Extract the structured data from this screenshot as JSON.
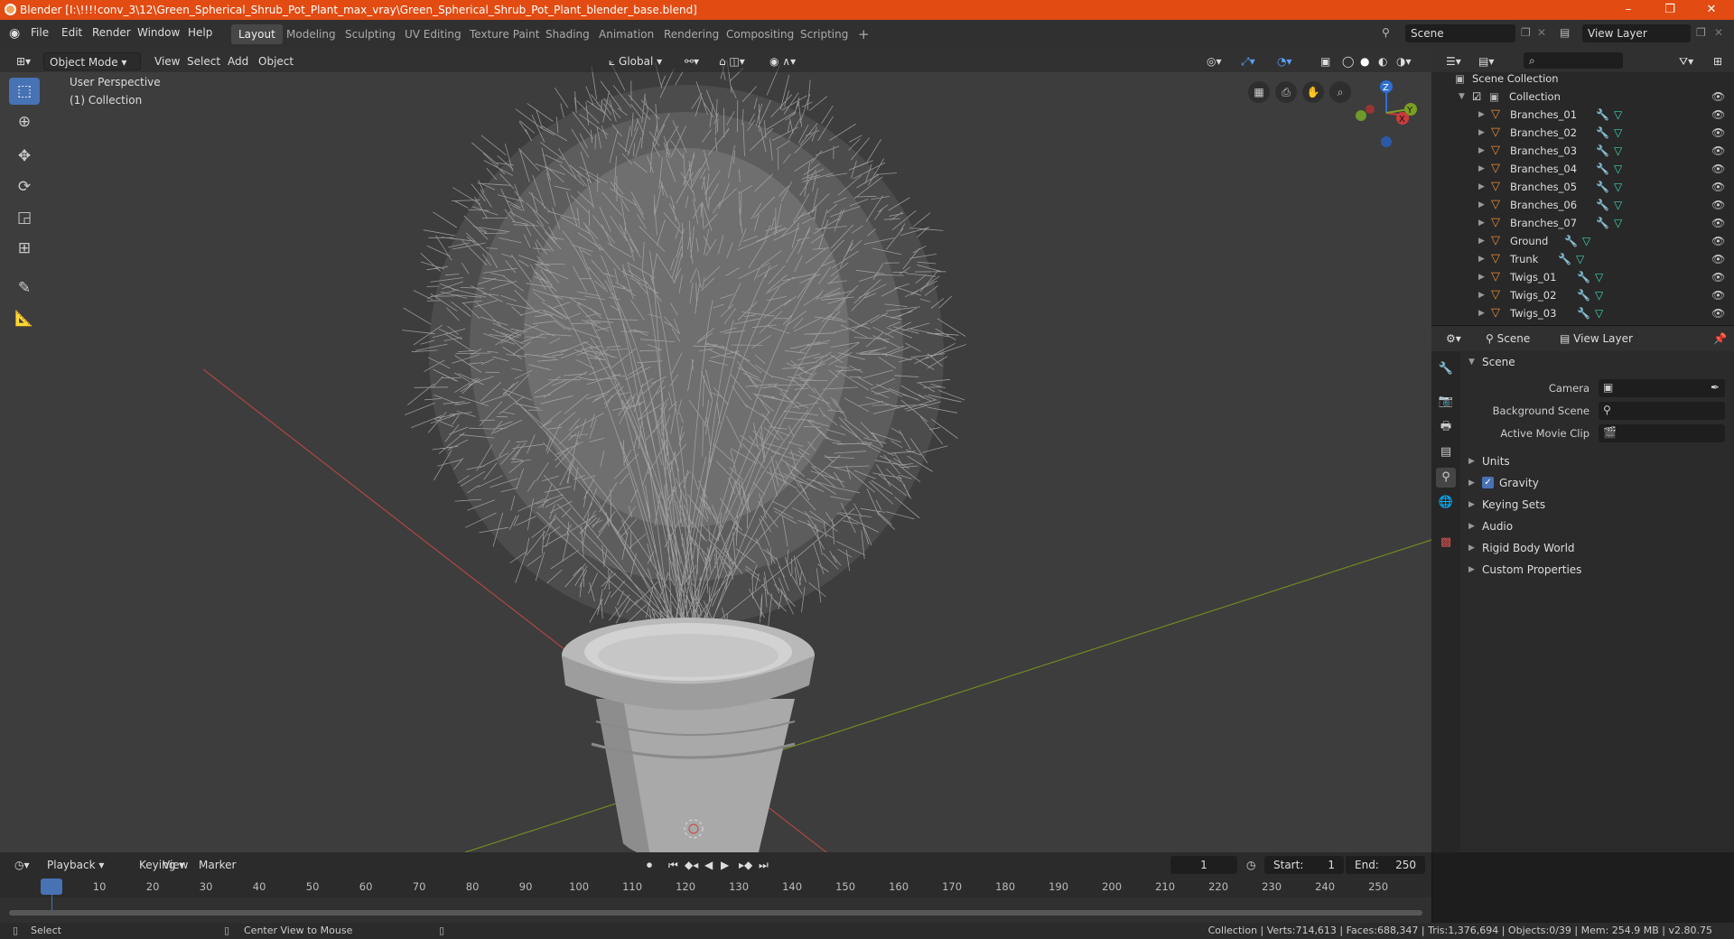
{
  "titlebar": {
    "title": "Blender [I:\\!!!!conv_3\\12\\Green_Spherical_Shrub_Pot_Plant_max_vray\\Green_Spherical_Shrub_Pot_Plant_blender_base.blend]",
    "minimize": "–",
    "maximize": "❐",
    "close": "✕"
  },
  "menu": [
    "File",
    "Edit",
    "Render",
    "Window",
    "Help"
  ],
  "workspaces": [
    "Layout",
    "Modeling",
    "Sculpting",
    "UV Editing",
    "Texture Paint",
    "Shading",
    "Animation",
    "Rendering",
    "Compositing",
    "Scripting"
  ],
  "workspace_add": "+",
  "scene_field": "Scene",
  "view_layer_field": "View Layer",
  "viewport_header": {
    "mode": "Object Mode",
    "menus": [
      "View",
      "Select",
      "Add",
      "Object"
    ],
    "orientation": "Global"
  },
  "viewport_overlay": {
    "perspective": "User Perspective",
    "collection": "(1) Collection"
  },
  "gizmo": {
    "z": "Z",
    "y": "Y",
    "x": "X"
  },
  "outliner": {
    "scene_collection": "Scene Collection",
    "collection": "Collection",
    "items": [
      "Branches_01",
      "Branches_02",
      "Branches_03",
      "Branches_04",
      "Branches_05",
      "Branches_06",
      "Branches_07",
      "Ground",
      "Trunk",
      "Twigs_01",
      "Twigs_02",
      "Twigs_03"
    ]
  },
  "properties": {
    "tab_scene": "Scene",
    "tab_view_layer": "View Layer",
    "section_scene": "Scene",
    "camera_label": "Camera",
    "background_scene_label": "Background Scene",
    "active_movie_clip_label": "Active Movie Clip",
    "sections": [
      "Units",
      "Gravity",
      "Keying Sets",
      "Audio",
      "Rigid Body World",
      "Custom Properties"
    ]
  },
  "timeline": {
    "menus": [
      "Playback",
      "Keying",
      "View",
      "Marker"
    ],
    "current_frame": "1",
    "start_label": "Start:",
    "start": "1",
    "end_label": "End:",
    "end": "250",
    "ticks": [
      "1",
      "10",
      "20",
      "30",
      "40",
      "50",
      "60",
      "70",
      "80",
      "90",
      "100",
      "110",
      "120",
      "130",
      "140",
      "150",
      "160",
      "170",
      "180",
      "190",
      "200",
      "210",
      "220",
      "230",
      "240",
      "250"
    ]
  },
  "statusbar": {
    "select": "Select",
    "center_view": "Center View to Mouse",
    "stats": "Collection | Verts:714,613 | Faces:688,347 | Tris:1,376,694 | Objects:0/39 | Mem: 254.9 MB | v2.80.75"
  },
  "colors": {
    "titlebar": "#e24b12",
    "accent": "#4772b3",
    "viewport": "#3d3d3d",
    "x_axis": "#c83c3c",
    "y_axis": "#7aa022"
  }
}
